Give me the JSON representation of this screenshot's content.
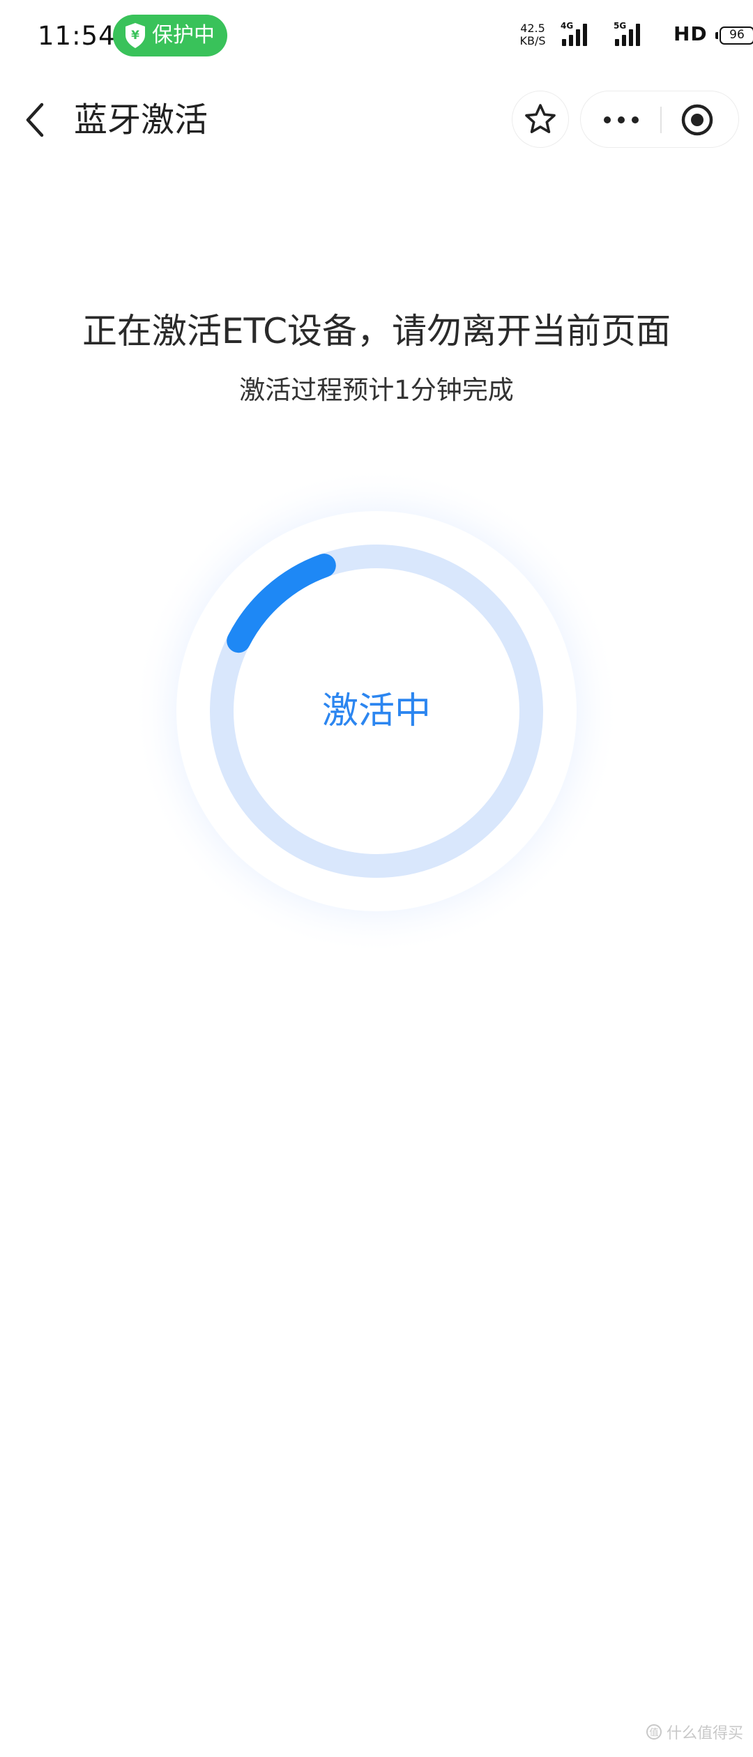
{
  "status_bar": {
    "time": "11:54",
    "protect_label": "保护中",
    "shield_symbol": "¥",
    "net_speed_value": "42.5",
    "net_speed_unit": "KB/S",
    "signal1_tag": "4G",
    "signal2_tag": "5G",
    "hd_label": "HD",
    "battery_level": "96",
    "pill_color": "#39c25a"
  },
  "nav": {
    "title": "蓝牙激活",
    "icons": [
      "back-icon",
      "star-icon",
      "more-icon",
      "target-icon"
    ]
  },
  "content": {
    "headline": "正在激活ETC设备，请勿离开当前页面",
    "subline": "激活过程预计1分钟完成",
    "ring_label": "激活中",
    "accent_color": "#2c86f0",
    "progress_fraction": 0.12
  },
  "watermark": {
    "text": "什么值得买"
  }
}
